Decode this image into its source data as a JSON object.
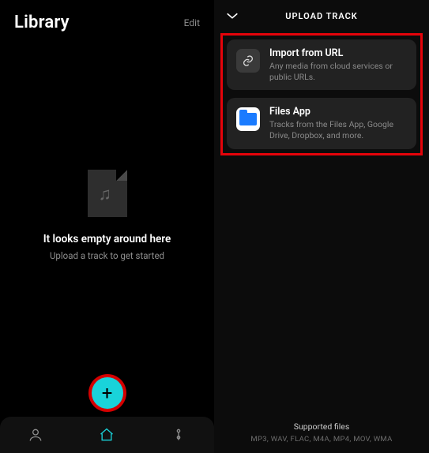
{
  "left": {
    "title": "Library",
    "edit": "Edit",
    "empty_title": "It looks empty around here",
    "empty_sub": "Upload a track to get started"
  },
  "right": {
    "title": "UPLOAD TRACK",
    "options": [
      {
        "title": "Import from URL",
        "desc": "Any media from cloud services or public URLs."
      },
      {
        "title": "Files App",
        "desc": "Tracks from the Files App, Google Drive, Dropbox, and more."
      }
    ],
    "supported_label": "Supported files",
    "supported_formats": "MP3, WAV, FLAC, M4A, MP4, MOV, WMA"
  }
}
